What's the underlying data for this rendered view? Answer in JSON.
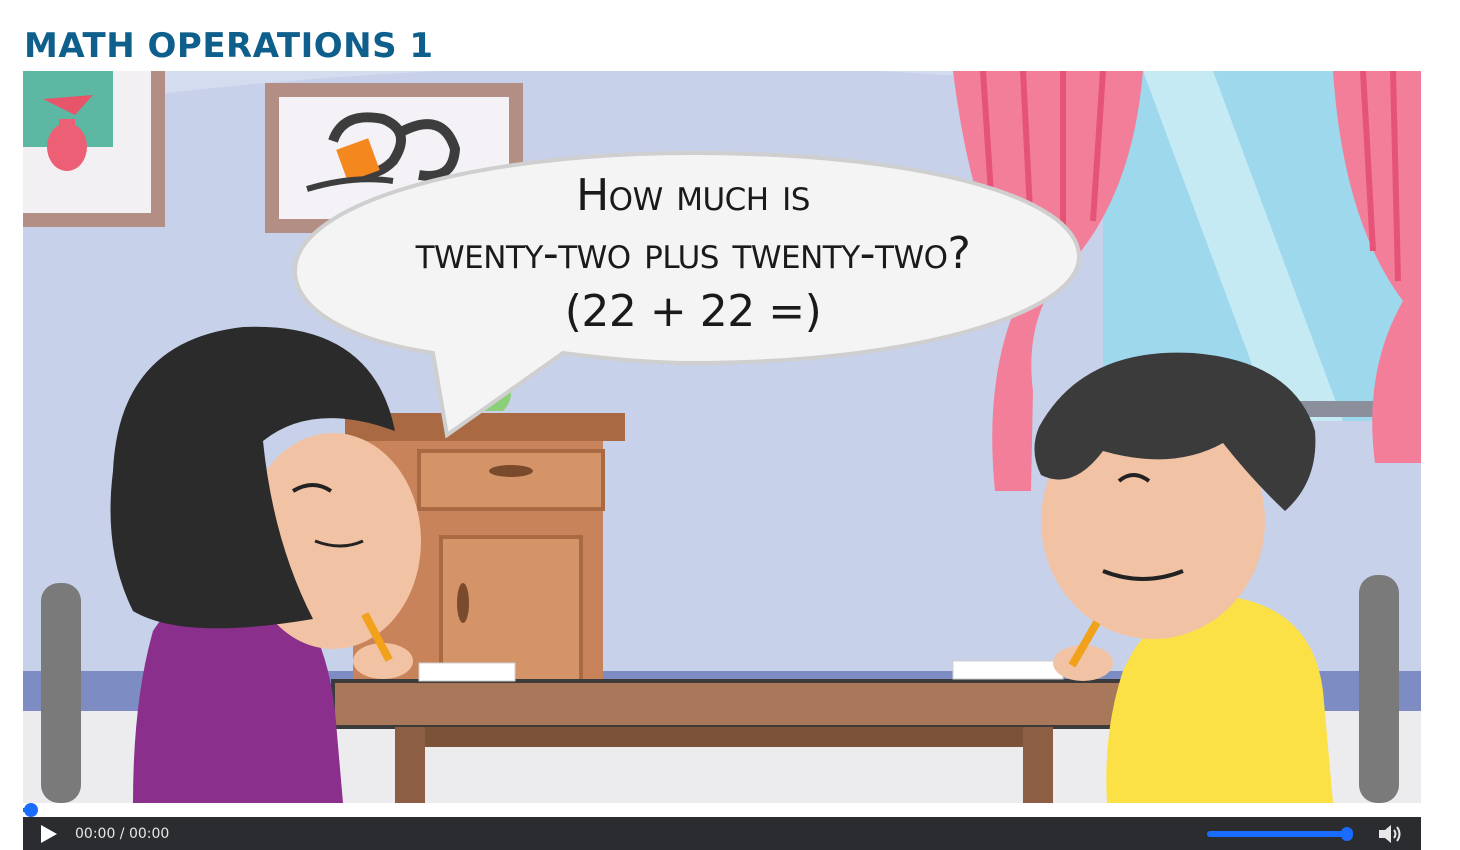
{
  "page": {
    "title": "MATH OPERATIONS 1"
  },
  "video": {
    "speech_lines": [
      "How much is",
      "twenty-two plus twenty-two?",
      "(22 + 22 =)"
    ],
    "progress_fraction": 0.0,
    "volume_fraction": 1.0
  },
  "controls": {
    "time_display": "00:00 / 00:00",
    "accent_color": "#1a6cff"
  },
  "colors": {
    "title": "#0f5f8c",
    "wall": "#c9d2ea",
    "curtain": "#f27e99",
    "table": "#a9785a"
  }
}
